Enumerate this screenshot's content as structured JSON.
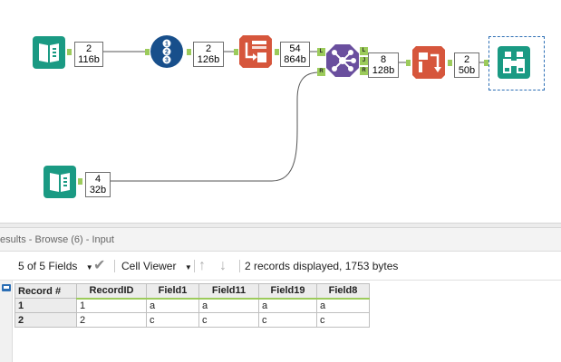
{
  "workflow": {
    "badges": [
      {
        "count": "2",
        "size": "116b"
      },
      {
        "count": "2",
        "size": "126b"
      },
      {
        "count": "54",
        "size": "864b"
      },
      {
        "count": "8",
        "size": "128b"
      },
      {
        "count": "2",
        "size": "50b"
      },
      {
        "count": "4",
        "size": "32b"
      }
    ],
    "join_anchors": {
      "left": "L",
      "right": "R"
    },
    "join_outputs": {
      "left": "L",
      "join": "J",
      "right": "R"
    },
    "tools": [
      {
        "name": "input-data-tool-1",
        "icon": "book-icon",
        "color": "#1a9a83"
      },
      {
        "name": "record-id-tool",
        "icon": "numbered-list-icon",
        "color": "#184f8b"
      },
      {
        "name": "transpose-tool",
        "icon": "transpose-icon",
        "color": "#d6563c"
      },
      {
        "name": "join-tool",
        "icon": "network-icon",
        "color": "#6a4f9e"
      },
      {
        "name": "crosstab-tool",
        "icon": "crosstab-icon",
        "color": "#d6563c"
      },
      {
        "name": "browse-tool",
        "icon": "binoculars-icon",
        "color": "#1a9a83"
      },
      {
        "name": "input-data-tool-2",
        "icon": "book-icon",
        "color": "#1a9a83"
      }
    ]
  },
  "results": {
    "title": "esults - Browse (6) - Input",
    "fields_selector": "5 of 5 Fields",
    "viewer_selector": "Cell Viewer",
    "status": "2 records displayed, 1753 bytes",
    "columns": [
      "Record #",
      "RecordID",
      "Field1",
      "Field11",
      "Field19",
      "Field8"
    ],
    "rows": [
      [
        "1",
        "1",
        "a",
        "a",
        "a",
        "a"
      ],
      [
        "2",
        "2",
        "c",
        "c",
        "c",
        "c"
      ]
    ]
  },
  "colors": {
    "anchor": "#9ccb5b",
    "selection": "#2c6fb5"
  }
}
